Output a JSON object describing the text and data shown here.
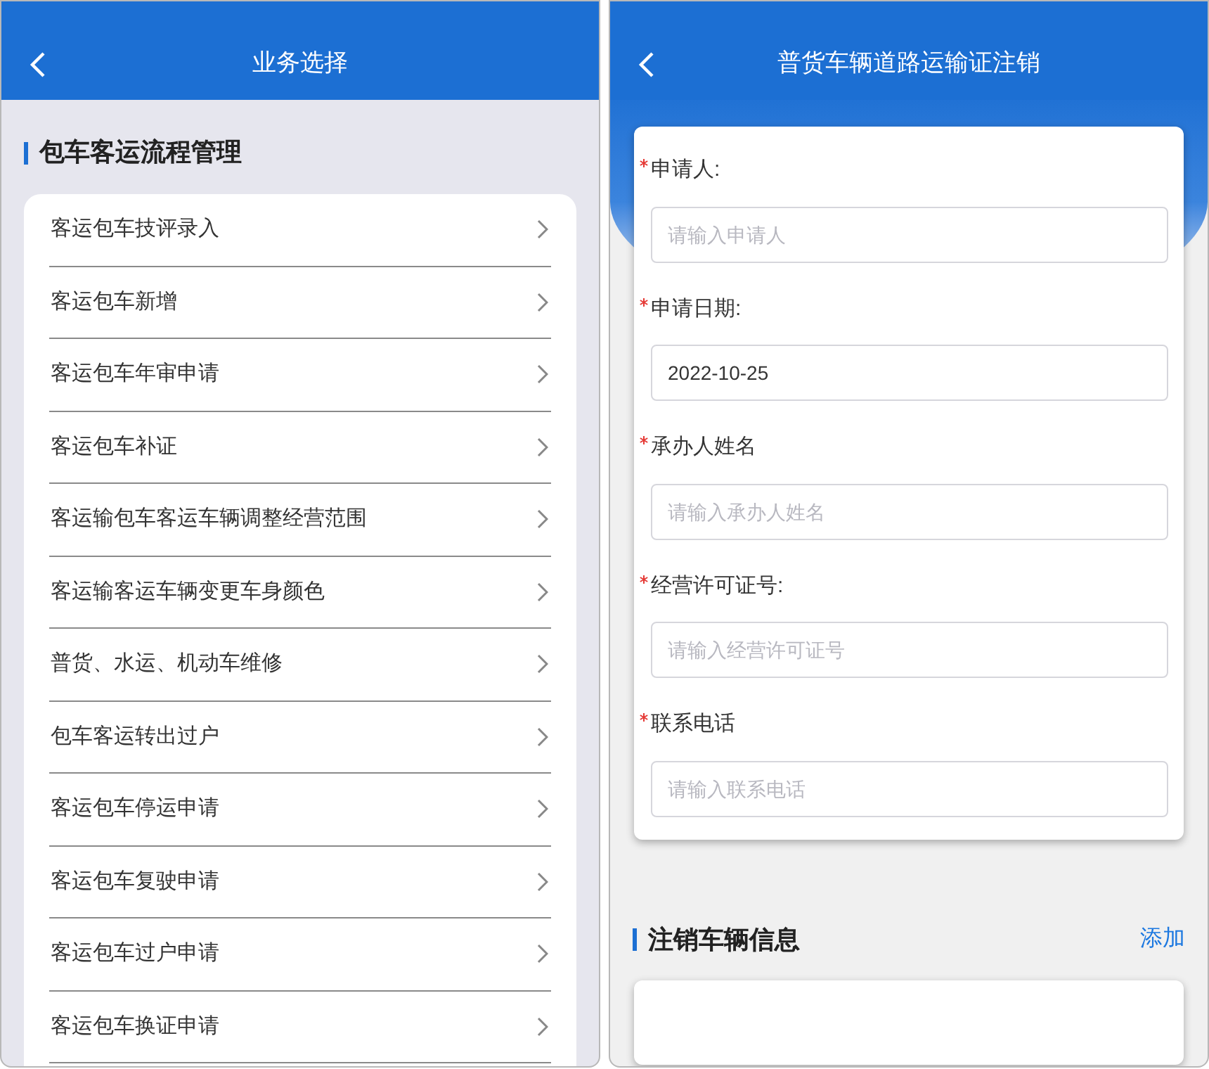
{
  "screens": [
    {
      "header": {
        "title": "业务选择"
      },
      "section": {
        "title": "包车客运流程管理"
      },
      "items": [
        {
          "label": "客运包车技评录入"
        },
        {
          "label": "客运包车新增"
        },
        {
          "label": "客运包车年审申请"
        },
        {
          "label": "客运包车补证"
        },
        {
          "label": "客运输包车客运车辆调整经营范围"
        },
        {
          "label": "客运输客运车辆变更车身颜色"
        },
        {
          "label": "普货、水运、机动车维修"
        },
        {
          "label": "包车客运转出过户"
        },
        {
          "label": "客运包车停运申请"
        },
        {
          "label": "客运包车复驶申请"
        },
        {
          "label": "客运包车过户申请"
        },
        {
          "label": "客运包车换证申请"
        }
      ]
    },
    {
      "header": {
        "title": "普货车辆道路运输证注销"
      },
      "fields": [
        {
          "label": "申请人:",
          "required": true,
          "placeholder": "请输入申请人"
        },
        {
          "label": "申请日期:",
          "required": true,
          "value": "2022-10-25"
        },
        {
          "label": "承办人姓名",
          "required": true,
          "placeholder": "请输入承办人姓名"
        },
        {
          "label": "经营许可证号:",
          "required": true,
          "placeholder": "请输入经营许可证号"
        },
        {
          "label": "联系电话",
          "required": true,
          "placeholder": "请输入联系电话"
        }
      ],
      "section": {
        "title": "注销车辆信息",
        "action": "添加"
      }
    }
  ]
}
